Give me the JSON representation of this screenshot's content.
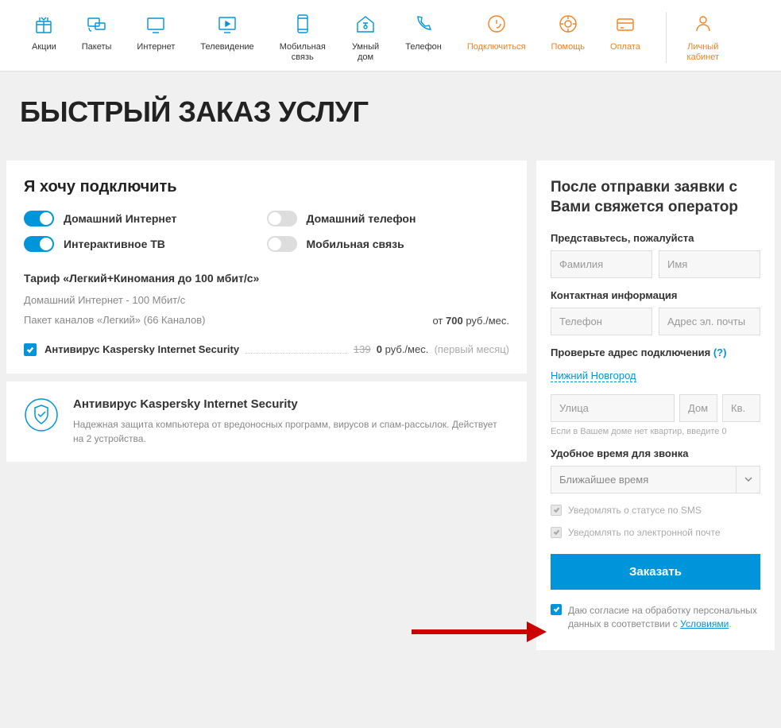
{
  "nav": [
    {
      "label": "Акции",
      "cls": "blue"
    },
    {
      "label": "Пакеты",
      "cls": "blue"
    },
    {
      "label": "Интернет",
      "cls": "blue"
    },
    {
      "label": "Телевидение",
      "cls": "blue"
    },
    {
      "label": "Мобильная связь",
      "cls": "blue"
    },
    {
      "label": "Умный дом",
      "cls": "blue"
    },
    {
      "label": "Телефон",
      "cls": "blue"
    },
    {
      "label": "Подключиться",
      "cls": "orange"
    },
    {
      "label": "Помощь",
      "cls": "orange"
    },
    {
      "label": "Оплата",
      "cls": "orange"
    },
    {
      "label": "Личный кабинет",
      "cls": "orange"
    }
  ],
  "page_title": "БЫСТРЫЙ ЗАКАЗ УСЛУГ",
  "left": {
    "title": "Я хочу подключить",
    "toggles": [
      {
        "label": "Домашний Интернет",
        "on": true
      },
      {
        "label": "Домашний телефон",
        "on": false
      },
      {
        "label": "Интерактивное ТВ",
        "on": true
      },
      {
        "label": "Мобильная связь",
        "on": false
      }
    ],
    "tariff_name": "Тариф «Легкий+Киномания до 100 мбит/с»",
    "tariff_line1": "Домашний Интернет - 100 Мбит/с",
    "tariff_line2": "Пакет каналов «Легкий» (66 Каналов)",
    "tariff_price_prefix": "от ",
    "tariff_price_bold": "700",
    "tariff_price_suffix": " руб./мес.",
    "kasper_label": "Антивирус Kaspersky Internet Security",
    "kasper_strike": "139",
    "kasper_price": "0",
    "kasper_unit": " руб./мес.",
    "kasper_note": "(первый месяц)",
    "kasper_panel_title": "Антивирус Kaspersky Internet Security",
    "kasper_panel_desc": "Надежная защита компьютера от вредоносных программ, вирусов и спам-рассылок. Действует на 2 устройства."
  },
  "right": {
    "title": "После отправки заявки с Вами свяжется оператор",
    "introduce": "Представьтесь, пожалуйста",
    "ph_surname": "Фамилия",
    "ph_name": "Имя",
    "contact": "Контактная информация",
    "ph_phone": "Телефон",
    "ph_email": "Адрес эл. почты",
    "check_addr": "Проверьте адрес подключения ",
    "help": "(?)",
    "city": "Нижний Новгород",
    "ph_street": "Улица",
    "ph_house": "Дом",
    "ph_apt": "Кв.",
    "hint": "Если в Вашем доме нет квартир, введите 0",
    "call_time": "Удобное время для звонка",
    "call_time_val": "Ближайшее время",
    "cb_sms": "Уведомлять о статусе по SMS",
    "cb_email": "Уведомлять по электронной почте",
    "order_btn": "Заказать",
    "consent_pre": "Даю согласие на обработку персональных данных в соответствии с ",
    "consent_link": "Условиями",
    "consent_suf": "."
  }
}
